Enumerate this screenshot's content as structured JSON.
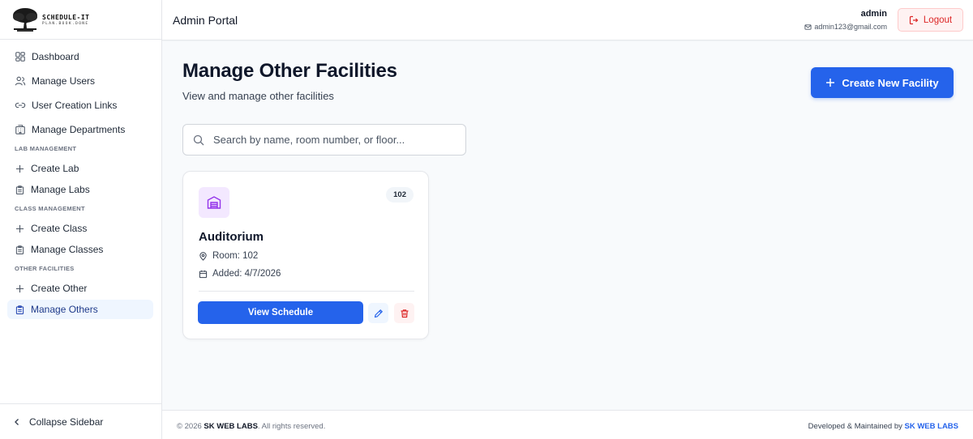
{
  "brand": {
    "name": "SCHEDULE-IT",
    "tagline": "PLAN.BOOK.DONE"
  },
  "sidebar": {
    "items": [
      {
        "label": "Dashboard",
        "icon": "dashboard-icon"
      },
      {
        "label": "Manage Users",
        "icon": "users-icon"
      },
      {
        "label": "User Creation Links",
        "icon": "link-icon"
      },
      {
        "label": "Manage Departments",
        "icon": "building-icon"
      }
    ],
    "sections": [
      {
        "title": "LAB MANAGEMENT",
        "items": [
          {
            "label": "Create Lab",
            "icon": "plus-icon"
          },
          {
            "label": "Manage Labs",
            "icon": "clipboard-icon"
          }
        ]
      },
      {
        "title": "CLASS MANAGEMENT",
        "items": [
          {
            "label": "Create Class",
            "icon": "plus-icon"
          },
          {
            "label": "Manage Classes",
            "icon": "clipboard-icon"
          }
        ]
      },
      {
        "title": "OTHER FACILITIES",
        "items": [
          {
            "label": "Create Other",
            "icon": "plus-icon"
          },
          {
            "label": "Manage Others",
            "icon": "clipboard-icon",
            "active": true
          }
        ]
      }
    ],
    "collapse_label": "Collapse Sidebar"
  },
  "header": {
    "title": "Admin Portal",
    "user_name": "admin",
    "user_email": "admin123@gmail.com",
    "logout_label": "Logout"
  },
  "main": {
    "title": "Manage Other Facilities",
    "subtitle": "View and manage other facilities",
    "create_button_label": "Create New Facility",
    "search": {
      "placeholder": "Search by name, room number, or floor...",
      "value": ""
    },
    "facilities": [
      {
        "name": "Auditorium",
        "room_badge": "102",
        "room_text": "Room: 102",
        "added_text": "Added: 4/7/2026",
        "view_label": "View Schedule"
      }
    ]
  },
  "footer": {
    "copyright_prefix": "© 2026 ",
    "company": "SK WEB LABS",
    "copyright_suffix": ". All rights reserved.",
    "right_prefix": "Developed & Maintained by ",
    "right_company": "SK WEB LABS"
  },
  "colors": {
    "primary": "#2563eb",
    "danger": "#dc2626",
    "accent_purple": "#9333ea",
    "active_bg": "#eff6ff"
  }
}
